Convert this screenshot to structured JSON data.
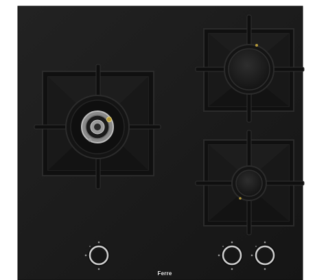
{
  "hob": {
    "brand": "Ferre",
    "glass_color": "#1b1b1b",
    "grate_color": "#141414",
    "knob_ring_color": "#c9c9c9",
    "burners": [
      {
        "name": "wok-burner",
        "type": "triple-crown"
      },
      {
        "name": "rear-right-burner",
        "type": "standard"
      },
      {
        "name": "front-right-burner",
        "type": "standard"
      }
    ],
    "knobs": [
      {
        "name": "knob-wok-burner"
      },
      {
        "name": "knob-right-burner-1"
      },
      {
        "name": "knob-right-burner-2"
      }
    ]
  }
}
